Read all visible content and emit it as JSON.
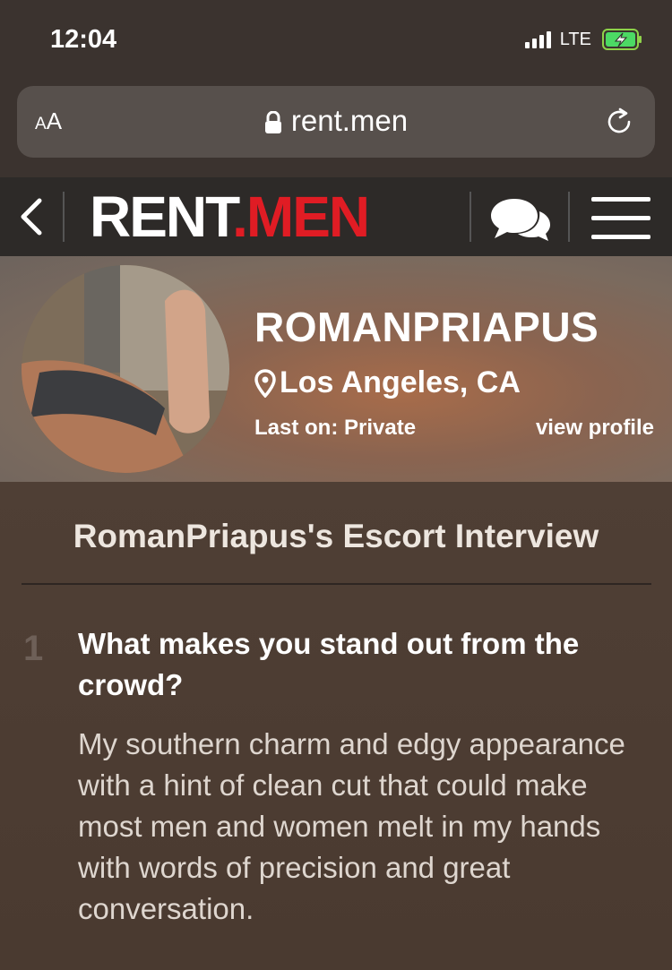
{
  "status_bar": {
    "time": "12:04",
    "network": "LTE"
  },
  "browser": {
    "text_size_label_small": "A",
    "text_size_label_large": "A",
    "url": "rent.men"
  },
  "site_header": {
    "logo_part1": "RENT",
    "logo_dot": ".",
    "logo_part2": "MEN",
    "brand_red": "#e01c24"
  },
  "profile": {
    "username": "ROMANPRIAPUS",
    "location": "Los Angeles, CA",
    "last_on": "Last on: Private",
    "view_profile_label": "view profile"
  },
  "interview": {
    "title": "RomanPriapus's Escort Interview",
    "items": [
      {
        "number": "1",
        "question": "What makes you stand out from the crowd?",
        "answer": "My southern charm and edgy appearance with a hint of clean cut that could make most men and women melt in my hands with words of precision and great conversation."
      }
    ]
  },
  "icons": [
    "signal-icon",
    "battery-charging-icon",
    "lock-icon",
    "reload-icon",
    "back-icon",
    "chat-icon",
    "menu-icon",
    "location-pin-icon"
  ]
}
